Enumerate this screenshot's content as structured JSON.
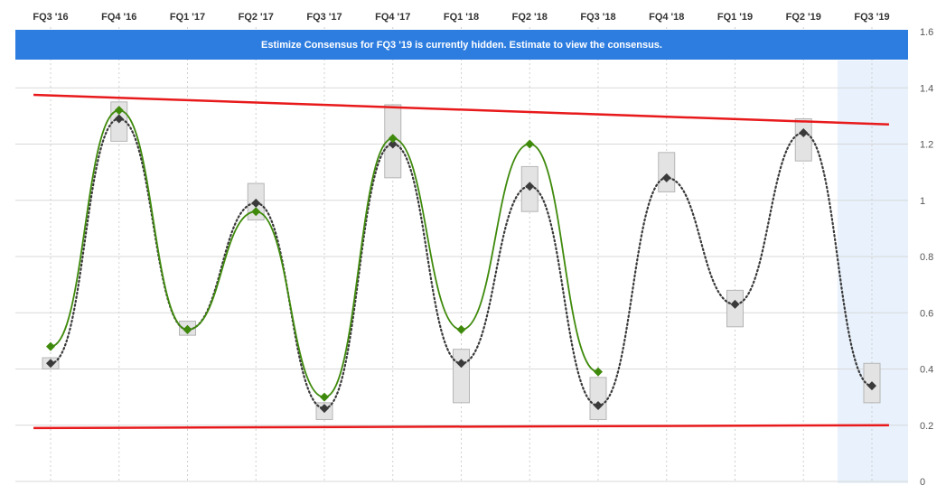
{
  "banner": {
    "text": "Estimize Consensus for FQ3 '19 is currently hidden. Estimate to view the consensus.",
    "color": "#2d7de0"
  },
  "colors": {
    "actual": "#3f8a0c",
    "estimate": "#3a3a3a",
    "trendline": "#e8191b",
    "highlight": "#e8f1fc",
    "range_fill": "#e3e3e3",
    "range_stroke": "#b5b5b5"
  },
  "chart_data": {
    "type": "line",
    "categories": [
      "FQ3 '16",
      "FQ4 '16",
      "FQ1 '17",
      "FQ2 '17",
      "FQ3 '17",
      "FQ4 '17",
      "FQ1 '18",
      "FQ2 '18",
      "FQ3 '18",
      "FQ4 '18",
      "FQ1 '19",
      "FQ2 '19",
      "FQ3 '19"
    ],
    "ylim": [
      0,
      1.6
    ],
    "yticks": [
      "0",
      "0.2",
      "0.4",
      "0.6",
      "0.8",
      "1",
      "1.2",
      "1.4",
      "1.6"
    ],
    "grid": true,
    "highlighted_category": "FQ3 '19",
    "series": [
      {
        "style": "solid-green-diamonds",
        "values": [
          0.48,
          1.32,
          0.54,
          0.96,
          0.3,
          1.22,
          0.54,
          1.2,
          0.39,
          null,
          null,
          null,
          null
        ]
      },
      {
        "style": "dotted-dark-diamonds",
        "values": [
          0.42,
          1.29,
          0.54,
          0.99,
          0.26,
          1.2,
          0.42,
          1.05,
          0.27,
          1.08,
          0.63,
          1.24,
          0.34
        ]
      }
    ],
    "ranges": [
      [
        0.4,
        0.44
      ],
      [
        1.21,
        1.35
      ],
      [
        0.52,
        0.57
      ],
      [
        0.93,
        1.06
      ],
      [
        0.22,
        0.28
      ],
      [
        1.08,
        1.34
      ],
      [
        0.28,
        0.47
      ],
      [
        0.96,
        1.12
      ],
      [
        0.22,
        0.37
      ],
      [
        1.03,
        1.17
      ],
      [
        0.55,
        0.68
      ],
      [
        1.14,
        1.29
      ],
      [
        0.28,
        0.42
      ]
    ],
    "trendlines": [
      {
        "from": [
          -0.25,
          1.375
        ],
        "to": [
          12.25,
          1.27
        ]
      },
      {
        "from": [
          -0.25,
          0.19
        ],
        "to": [
          12.25,
          0.2
        ]
      }
    ]
  }
}
